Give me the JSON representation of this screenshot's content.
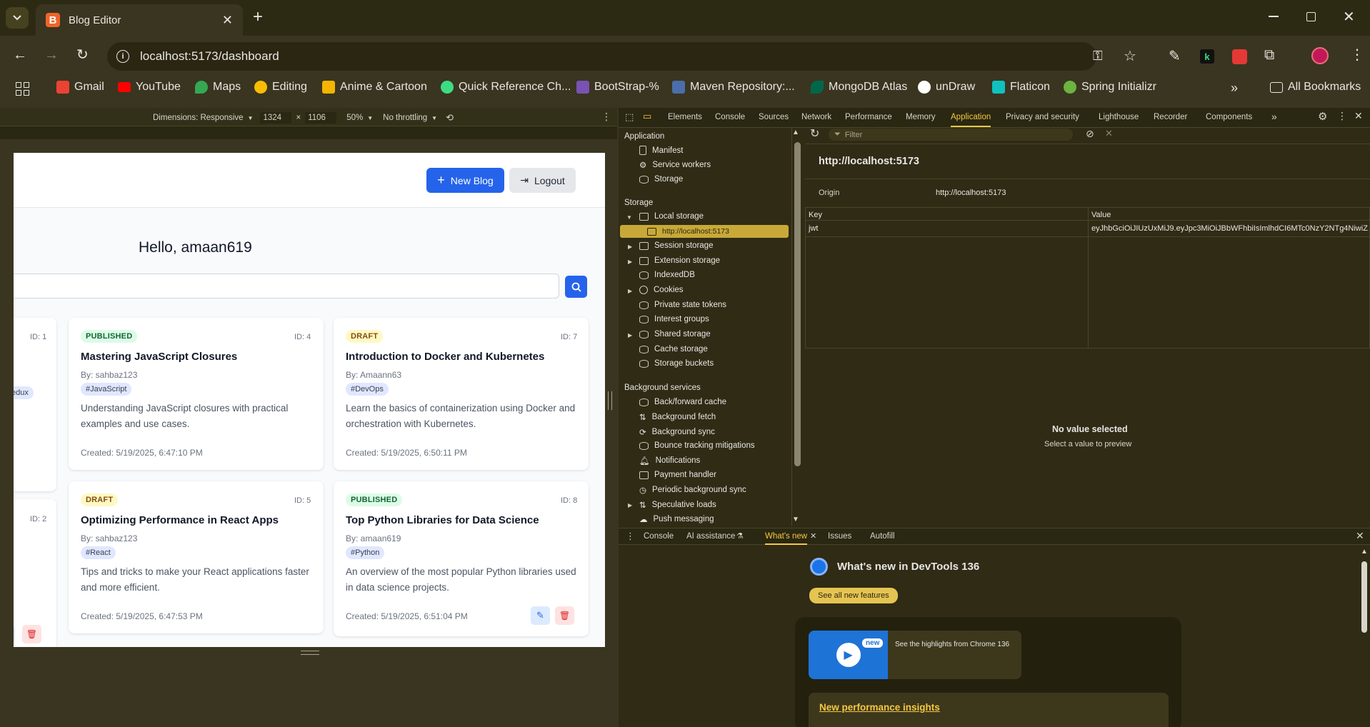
{
  "browser": {
    "tab_title": "Blog Editor",
    "url": "localhost:5173/dashboard",
    "bookmarks": [
      {
        "label": "Gmail",
        "color": "#ea4335"
      },
      {
        "label": "YouTube",
        "color": "#ff0000"
      },
      {
        "label": "Maps",
        "color": "#34a853"
      },
      {
        "label": "Editing",
        "color": "#fbbc04"
      },
      {
        "label": "Anime & Cartoon",
        "color": "#f4b400"
      },
      {
        "label": "Quick Reference Ch...",
        "color": "#3ddc84"
      },
      {
        "label": "BootStrap-%",
        "color": "#7952b3"
      },
      {
        "label": "Maven Repository:...",
        "color": "#4a6ea9"
      },
      {
        "label": "MongoDB Atlas",
        "color": "#00684a"
      },
      {
        "label": "unDraw",
        "color": "#ffffff"
      },
      {
        "label": "Flaticon",
        "color": "#0fc2c0"
      },
      {
        "label": "Spring Initializr",
        "color": "#6db33f"
      }
    ],
    "all_bookmarks": "All Bookmarks"
  },
  "device_toolbar": {
    "dimensions_label": "Dimensions: Responsive",
    "width": "1324",
    "times": "×",
    "height": "1106",
    "zoom": "50%",
    "throttle": "No throttling"
  },
  "app": {
    "new_blog_label": "New Blog",
    "logout_label": "Logout",
    "greeting": "Hello, amaan619",
    "partial_cards": [
      {
        "id": "ID: 1",
        "tag_fragment": "edux"
      },
      {
        "id": "ID: 2"
      }
    ],
    "cards": [
      {
        "status": "PUBLISHED",
        "id": "ID: 4",
        "title": "Mastering JavaScript Closures",
        "author": "By: sahbaz123",
        "tag": "#JavaScript",
        "desc": "Understanding JavaScript closures with practical examples and use cases.",
        "created": "Created: 5/19/2025, 6:47:10 PM"
      },
      {
        "status": "DRAFT",
        "id": "ID: 7",
        "title": "Introduction to Docker and Kubernetes",
        "author": "By: Amaann63",
        "tag": "#DevOps",
        "desc": "Learn the basics of containerization using Docker and orchestration with Kubernetes.",
        "created": "Created: 5/19/2025, 6:50:11 PM"
      },
      {
        "status": "DRAFT",
        "id": "ID: 5",
        "title": "Optimizing Performance in React Apps",
        "author": "By: sahbaz123",
        "tag": "#React",
        "desc": "Tips and tricks to make your React applications faster and more efficient.",
        "created": "Created: 5/19/2025, 6:47:53 PM"
      },
      {
        "status": "PUBLISHED",
        "id": "ID: 8",
        "title": "Top Python Libraries for Data Science",
        "author": "By: amaan619",
        "tag": "#Python",
        "desc": "An overview of the most popular Python libraries used in data science projects.",
        "created": "Created: 5/19/2025, 6:51:04 PM"
      }
    ]
  },
  "devtools": {
    "tabs": [
      "Elements",
      "Console",
      "Sources",
      "Network",
      "Performance",
      "Memory",
      "Application",
      "Privacy and security",
      "Lighthouse",
      "Recorder",
      "Components"
    ],
    "active_tab": "Application",
    "sidebar": {
      "application_header": "Application",
      "application_items": [
        "Manifest",
        "Service workers",
        "Storage"
      ],
      "storage_header": "Storage",
      "local_storage": "Local storage",
      "local_storage_child": "http://localhost:5173",
      "storage_items": [
        "Session storage",
        "Extension storage",
        "IndexedDB",
        "Cookies",
        "Private state tokens",
        "Interest groups",
        "Shared storage",
        "Cache storage",
        "Storage buckets"
      ],
      "background_header": "Background services",
      "background_items": [
        "Back/forward cache",
        "Background fetch",
        "Background sync",
        "Bounce tracking mitigations",
        "Notifications",
        "Payment handler",
        "Periodic background sync",
        "Speculative loads",
        "Push messaging"
      ]
    },
    "filter_placeholder": "Filter",
    "origin_title": "http://localhost:5173",
    "origin_label": "Origin",
    "origin_value": "http://localhost:5173",
    "table": {
      "key_header": "Key",
      "value_header": "Value",
      "rows": [
        {
          "key": "jwt",
          "value": "eyJhbGciOiJIUzUxMiJ9.eyJpc3MiOiJBbWFhbiIsImlhdCI6MTc0NzY2NTg4NiwiZ..."
        }
      ]
    },
    "no_value_title": "No value selected",
    "no_value_sub": "Select a value to preview",
    "drawer_tabs": [
      "Console",
      "AI assistance",
      "What's new",
      "Issues",
      "Autofill"
    ],
    "drawer_active": "What's new",
    "whatsnew_title": "What's new in DevTools 136",
    "see_all": "See all new features",
    "new_badge": "new",
    "highlight_text": "See the highlights from Chrome 136",
    "perf_link": "New performance insights"
  }
}
